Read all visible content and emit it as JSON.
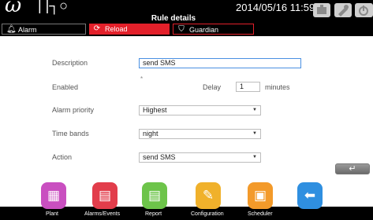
{
  "header": {
    "logo_text": "ω",
    "logo_rest": "| |┐○",
    "title": "Rule details",
    "datetime": "2014/05/16  11:59"
  },
  "tabs": [
    {
      "label": "Alarm",
      "icon": "bell-icon"
    },
    {
      "label": "Reload",
      "icon": "reload-icon"
    },
    {
      "label": "Guardian",
      "icon": "guardian-icon"
    }
  ],
  "form": {
    "description_label": "Description",
    "description_value": "send SMS",
    "enabled_label": "Enabled",
    "enabled_mark": "*",
    "delay_label": "Delay",
    "delay_value": "1",
    "minutes_label": "minutes",
    "priority_label": "Alarm priority",
    "priority_value": "Highest",
    "timebands_label": "Time bands",
    "timebands_value": "night",
    "action_label": "Action",
    "action_value": "send SMS"
  },
  "enter_glyph": "↵",
  "nav": [
    {
      "label": "Plant",
      "icon": "plant-icon",
      "color": "#c94fc0"
    },
    {
      "label": "Alarms/Events",
      "icon": "alarms-events-icon",
      "color": "#e23d4b"
    },
    {
      "label": "Report",
      "icon": "report-icon",
      "color": "#6dc44a"
    },
    {
      "label": "Configuration",
      "icon": "configuration-icon",
      "color": "#f0b12b"
    },
    {
      "label": "Scheduler",
      "icon": "scheduler-icon",
      "color": "#f39a2a"
    },
    {
      "label": "",
      "icon": "back-arrow-icon",
      "color": "#2f8fe0"
    }
  ],
  "colors": {
    "accent_red": "#e3202a",
    "field_focus": "#4a90e2"
  }
}
